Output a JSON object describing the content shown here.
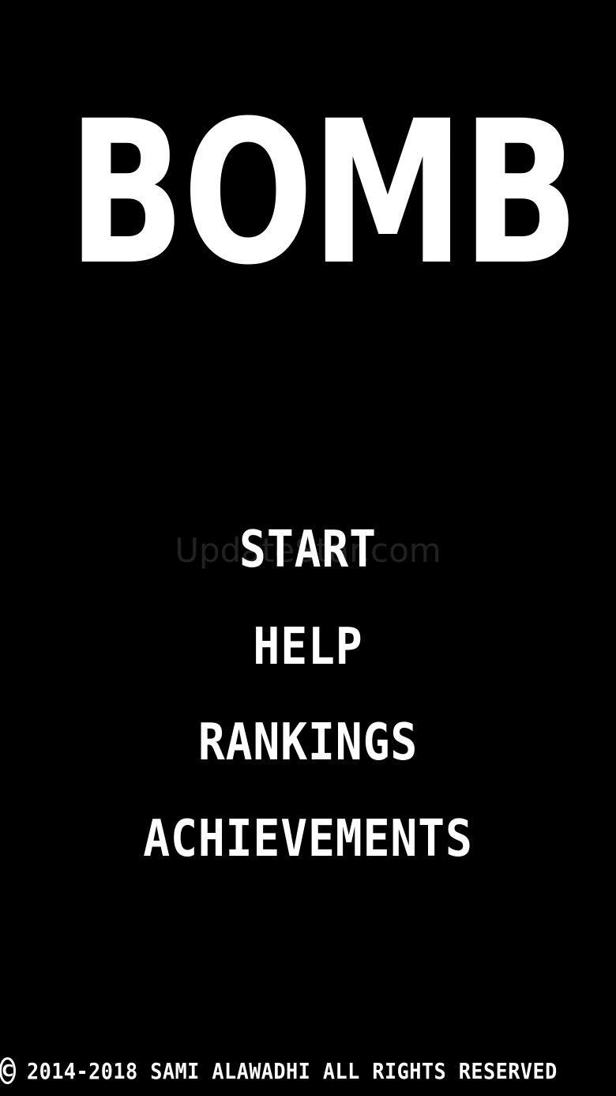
{
  "game": {
    "title": "BOMB"
  },
  "menu": {
    "start": "START",
    "help": "HELP",
    "rankings": "RANKINGS",
    "achievements": "ACHIEVEMENTS"
  },
  "watermark": "UpdateStar.com",
  "footer": {
    "copyright_symbol": "C",
    "text": "2014-2018 SAMI ALAWADHI ALL RIGHTS RESERVED"
  },
  "colors": {
    "background": "#000000",
    "text": "#ffffff"
  },
  "icons": {
    "copyright": "copyright-icon"
  }
}
